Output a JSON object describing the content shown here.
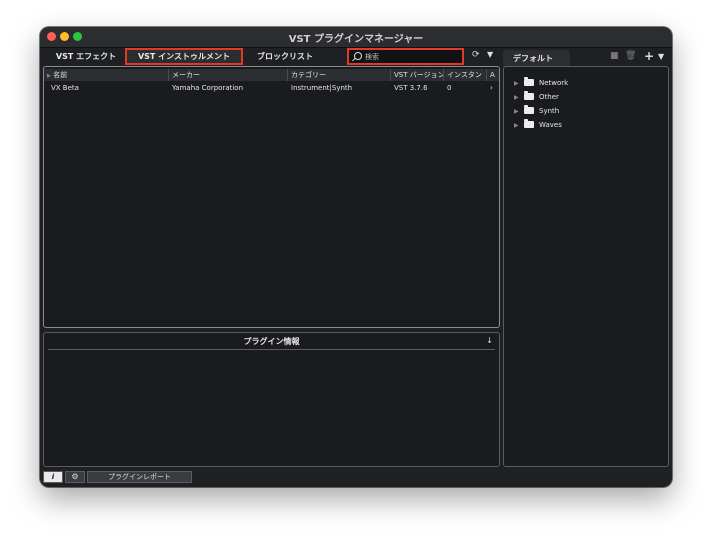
{
  "window": {
    "title": "VST プラグインマネージャー"
  },
  "tabs": {
    "effects": "VST エフェクト",
    "instruments": "VST インストゥルメント",
    "blocklist": "ブロックリスト"
  },
  "search": {
    "placeholder": "検索"
  },
  "right_panel": {
    "tab_label": "デフォルト",
    "tree": [
      {
        "label": "Network"
      },
      {
        "label": "Other"
      },
      {
        "label": "Synth"
      },
      {
        "label": "Waves"
      }
    ]
  },
  "table": {
    "columns": [
      "名前",
      "メーカー",
      "カテゴリー",
      "VST バージョン",
      "インスタン",
      "A"
    ],
    "rows": [
      {
        "name": "VX Beta",
        "maker": "Yamaha Corporation",
        "category": "Instrument|Synth",
        "version": "VST 3.7.6",
        "instances": "0",
        "extra": "›"
      }
    ]
  },
  "info": {
    "title": "プラグイン情報"
  },
  "bottom": {
    "info_button": "i",
    "report_button": "プラグインレポート"
  },
  "colors": {
    "highlight": "#e23a2a",
    "window_bg": "#1e2024"
  }
}
